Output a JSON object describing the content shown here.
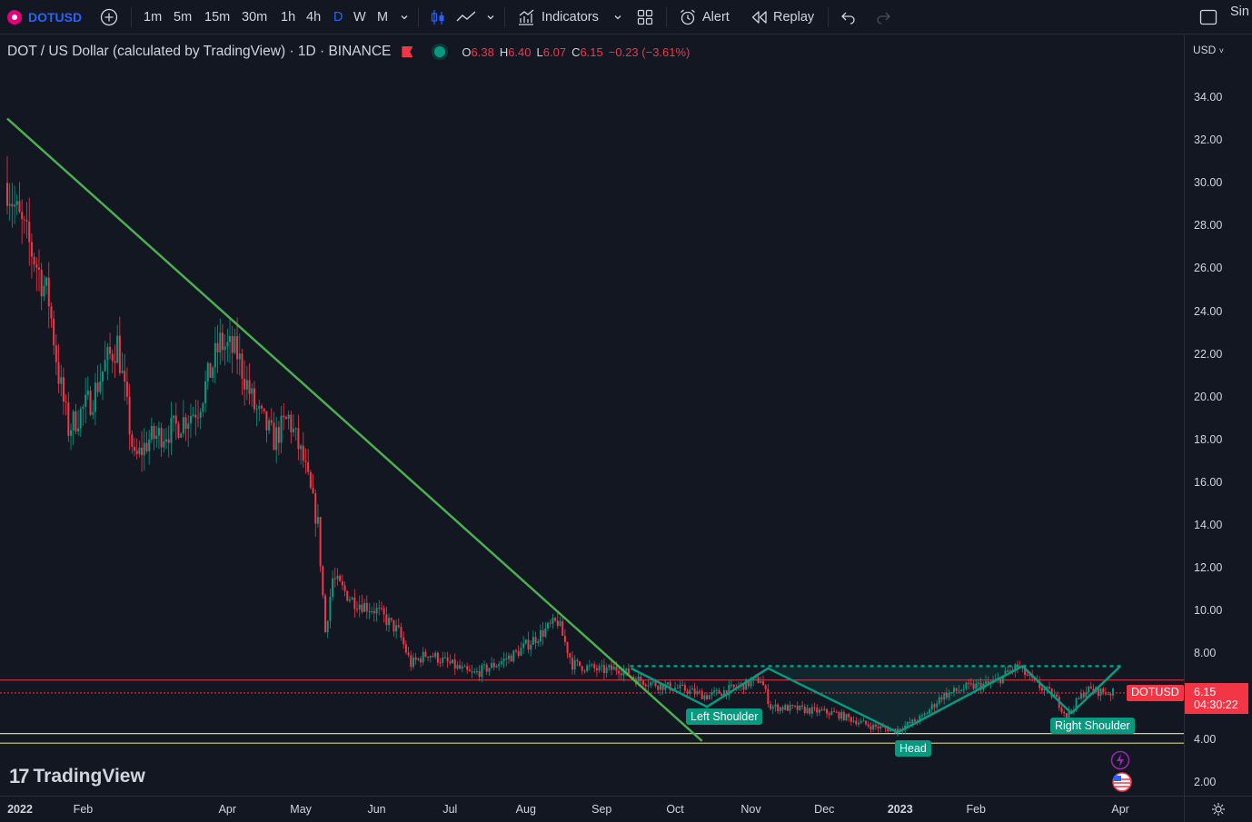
{
  "toolbar": {
    "symbol": "DOTUSD",
    "add_icon": "plus-circle-icon",
    "intervals": [
      "1m",
      "5m",
      "15m",
      "30m",
      "1h",
      "4h",
      "D",
      "W",
      "M"
    ],
    "active_interval": "D",
    "indicators_label": "Indicators",
    "alert_label": "Alert",
    "replay_label": "Replay",
    "right_label": "Sin"
  },
  "legend": {
    "title": "DOT / US Dollar (calculated by TradingView) · 1D · BINANCE",
    "ohlc": {
      "o_key": "O",
      "o": "6.38",
      "h_key": "H",
      "h": "6.40",
      "l_key": "L",
      "l": "6.07",
      "c_key": "C",
      "c": "6.15",
      "change": "−0.23 (−3.61%)"
    }
  },
  "price_scale": {
    "currency": "USD",
    "ticks": [
      "34.00",
      "32.00",
      "30.00",
      "28.00",
      "26.00",
      "24.00",
      "22.00",
      "20.00",
      "18.00",
      "16.00",
      "14.00",
      "12.00",
      "10.00",
      "8.00",
      "4.00",
      "2.00"
    ]
  },
  "time_scale": {
    "ticks": [
      "2022",
      "Feb",
      "Apr",
      "May",
      "Jun",
      "Jul",
      "Aug",
      "Sep",
      "Oct",
      "Nov",
      "Dec",
      "2023",
      "Feb",
      "Apr"
    ]
  },
  "last_price": {
    "symbol": "DOTUSD",
    "price": "6.15",
    "countdown": "04:30:22"
  },
  "pattern_labels": {
    "left": "Left Shoulder",
    "head": "Head",
    "right": "Right Shoulder"
  },
  "watermark": {
    "text": "TradingView"
  },
  "colors": {
    "background": "#131722",
    "up": "#089981",
    "down": "#f23645",
    "trendline": "#4caf50",
    "pattern": "#089981",
    "support": "#d4d46a",
    "accent": "#2962ff"
  },
  "chart_data": {
    "type": "candlestick",
    "title": "DOT / US Dollar",
    "ylim": [
      1.5,
      35.5
    ],
    "x_range": [
      "2022-01-01",
      "2023-04-03"
    ],
    "close_path": [
      {
        "x": "2022-01-01",
        "y": 30.0
      },
      {
        "x": "2022-01-05",
        "y": 28.5
      },
      {
        "x": "2022-01-12",
        "y": 26.5
      },
      {
        "x": "2022-01-18",
        "y": 24.5
      },
      {
        "x": "2022-01-22",
        "y": 21.0
      },
      {
        "x": "2022-01-26",
        "y": 18.5
      },
      {
        "x": "2022-02-05",
        "y": 20.0
      },
      {
        "x": "2022-02-10",
        "y": 21.5
      },
      {
        "x": "2022-02-15",
        "y": 22.5
      },
      {
        "x": "2022-02-22",
        "y": 17.0
      },
      {
        "x": "2022-02-28",
        "y": 18.0
      },
      {
        "x": "2022-03-10",
        "y": 18.5
      },
      {
        "x": "2022-03-20",
        "y": 19.5
      },
      {
        "x": "2022-03-29",
        "y": 22.5
      },
      {
        "x": "2022-04-05",
        "y": 22.0
      },
      {
        "x": "2022-04-12",
        "y": 19.5
      },
      {
        "x": "2022-04-20",
        "y": 18.0
      },
      {
        "x": "2022-04-26",
        "y": 19.0
      },
      {
        "x": "2022-05-02",
        "y": 17.0
      },
      {
        "x": "2022-05-08",
        "y": 14.0
      },
      {
        "x": "2022-05-11",
        "y": 9.0
      },
      {
        "x": "2022-05-14",
        "y": 11.5
      },
      {
        "x": "2022-05-22",
        "y": 10.5
      },
      {
        "x": "2022-06-01",
        "y": 10.0
      },
      {
        "x": "2022-06-10",
        "y": 9.0
      },
      {
        "x": "2022-06-15",
        "y": 7.5
      },
      {
        "x": "2022-06-22",
        "y": 8.0
      },
      {
        "x": "2022-07-01",
        "y": 7.5
      },
      {
        "x": "2022-07-10",
        "y": 7.0
      },
      {
        "x": "2022-07-20",
        "y": 7.5
      },
      {
        "x": "2022-07-28",
        "y": 8.0
      },
      {
        "x": "2022-08-08",
        "y": 9.0
      },
      {
        "x": "2022-08-14",
        "y": 9.5
      },
      {
        "x": "2022-08-20",
        "y": 7.5
      },
      {
        "x": "2022-09-01",
        "y": 7.2
      },
      {
        "x": "2022-09-08",
        "y": 7.3
      },
      {
        "x": "2022-09-15",
        "y": 6.8
      },
      {
        "x": "2022-09-25",
        "y": 6.5
      },
      {
        "x": "2022-10-05",
        "y": 6.3
      },
      {
        "x": "2022-10-14",
        "y": 6.0
      },
      {
        "x": "2022-10-26",
        "y": 6.4
      },
      {
        "x": "2022-11-05",
        "y": 6.8
      },
      {
        "x": "2022-11-09",
        "y": 5.5
      },
      {
        "x": "2022-11-20",
        "y": 5.4
      },
      {
        "x": "2022-12-05",
        "y": 5.2
      },
      {
        "x": "2022-12-20",
        "y": 4.6
      },
      {
        "x": "2022-12-30",
        "y": 4.4
      },
      {
        "x": "2023-01-10",
        "y": 5.0
      },
      {
        "x": "2023-01-18",
        "y": 6.0
      },
      {
        "x": "2023-01-28",
        "y": 6.4
      },
      {
        "x": "2023-02-08",
        "y": 6.6
      },
      {
        "x": "2023-02-18",
        "y": 7.4
      },
      {
        "x": "2023-02-25",
        "y": 6.6
      },
      {
        "x": "2023-03-05",
        "y": 6.0
      },
      {
        "x": "2023-03-10",
        "y": 5.1
      },
      {
        "x": "2023-03-18",
        "y": 6.3
      },
      {
        "x": "2023-03-25",
        "y": 6.2
      },
      {
        "x": "2023-03-29",
        "y": 6.15
      }
    ],
    "trendline": [
      {
        "x": "2022-01-01",
        "y": 33.0
      },
      {
        "x": "2022-10-12",
        "y": 3.9
      }
    ],
    "head_and_shoulders": [
      {
        "x": "2022-09-13",
        "y": 7.3
      },
      {
        "x": "2022-10-14",
        "y": 5.5
      },
      {
        "x": "2022-11-08",
        "y": 7.3
      },
      {
        "x": "2022-12-31",
        "y": 4.3
      },
      {
        "x": "2023-02-20",
        "y": 7.4
      },
      {
        "x": "2023-03-12",
        "y": 5.2
      },
      {
        "x": "2023-04-01",
        "y": 7.4
      }
    ],
    "neckline": {
      "y": 7.4,
      "from": "2022-09-13",
      "to": "2023-04-01"
    },
    "horizontal_lines": [
      6.75,
      6.15
    ],
    "support_lines": [
      4.25,
      3.8
    ]
  }
}
